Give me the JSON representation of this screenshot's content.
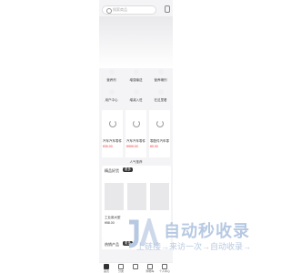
{
  "search": {
    "placeholder": "搜索商品"
  },
  "categories": [
    {
      "label": "营养剂"
    },
    {
      "label": "增强输送"
    },
    {
      "label": "营养辅剂"
    },
    {
      "label": "用户中心"
    },
    {
      "label": "增减入驻"
    },
    {
      "label": "在这里看"
    }
  ],
  "products_row1": [
    {
      "name": "汽车汽车零件工厂",
      "price": "¥30.00"
    },
    {
      "name": "汽车汽车零件工厂",
      "price": "¥999.00"
    },
    {
      "name": "零配件汽车零件",
      "price": "¥0.00"
    }
  ],
  "section": {
    "title": "人气推荐"
  },
  "card2": {
    "title": "精品好货",
    "tag": "更多",
    "item_name": "工业用大型",
    "item_price": "¥58.00"
  },
  "card3": {
    "title": "热销产品",
    "tag": "更多"
  },
  "tabbar": [
    {
      "label": "首页"
    },
    {
      "label": "分类"
    },
    {
      "label": ""
    },
    {
      "label": "购物车"
    },
    {
      "label": "个人中心"
    }
  ],
  "watermark": {
    "main": "自动秒收录",
    "sub": "上链接→来访一次→自动收录→"
  }
}
